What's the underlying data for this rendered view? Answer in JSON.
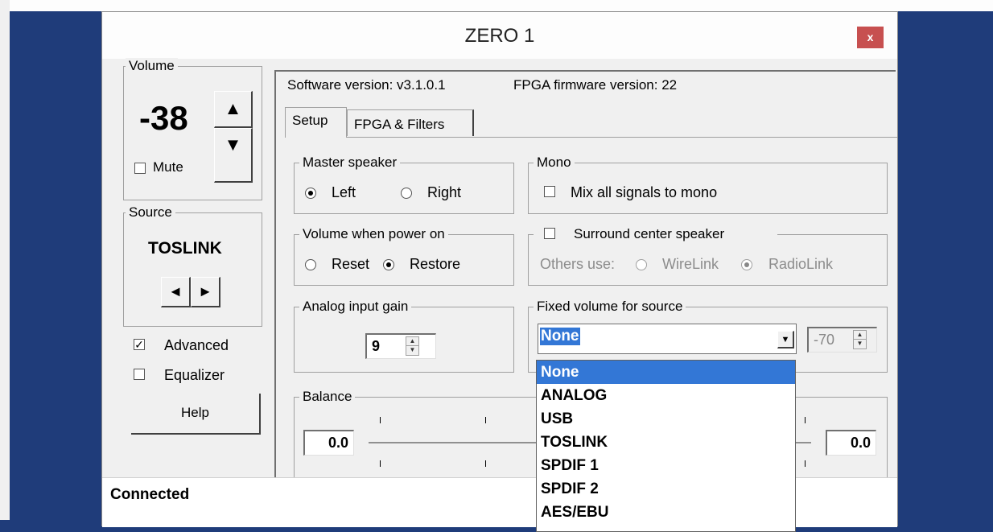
{
  "window": {
    "title": "ZERO 1",
    "close_label": "x"
  },
  "volume": {
    "legend": "Volume",
    "value": "-38",
    "up": "▲",
    "down": "▼",
    "mute_label": "Mute",
    "mute_checked": false
  },
  "source": {
    "legend": "Source",
    "value": "TOSLINK",
    "prev": "◄",
    "next": "►"
  },
  "advanced": {
    "label": "Advanced",
    "checked": true
  },
  "equalizer": {
    "label": "Equalizer",
    "checked": false
  },
  "help_label": "Help",
  "status": "Connected",
  "versions": {
    "software": "Software version: v3.1.0.1",
    "fpga": "FPGA firmware version:  22"
  },
  "tabs": [
    {
      "label": "Setup",
      "active": true
    },
    {
      "label": "FPGA & Filters",
      "active": false
    }
  ],
  "master_speaker": {
    "legend": "Master speaker",
    "left": "Left",
    "right": "Right",
    "selected": "Left"
  },
  "mono": {
    "legend": "Mono",
    "option": "Mix all signals to mono",
    "checked": false
  },
  "volume_power_on": {
    "legend": "Volume when power on",
    "reset": "Reset",
    "restore": "Restore",
    "selected": "Restore"
  },
  "surround": {
    "label": "Surround center speaker",
    "checked": false,
    "others_use": "Others use:",
    "wirelink": "WireLink",
    "radiolink": "RadioLink",
    "selected": "RadioLink"
  },
  "analog_gain": {
    "legend": "Analog input gain",
    "value": "9"
  },
  "fixed_volume": {
    "legend": "Fixed volume for source",
    "selected": "None",
    "level": "-70"
  },
  "balance": {
    "legend": "Balance",
    "left_value": "0.0",
    "right_value": "0.0"
  },
  "dropdown": {
    "options": [
      "None",
      "ANALOG",
      "USB",
      "TOSLINK",
      "SPDIF 1",
      "SPDIF 2",
      "AES/EBU"
    ],
    "highlighted": "None"
  },
  "icons": {
    "close": "close-icon",
    "up": "arrow-up-icon",
    "down": "arrow-down-icon",
    "prev": "arrow-left-icon",
    "next": "arrow-right-icon",
    "combo": "chevron-down-icon"
  },
  "colors": {
    "desktop": "#1f3c7a",
    "close_button": "#c75050",
    "selection": "#3377d6"
  }
}
